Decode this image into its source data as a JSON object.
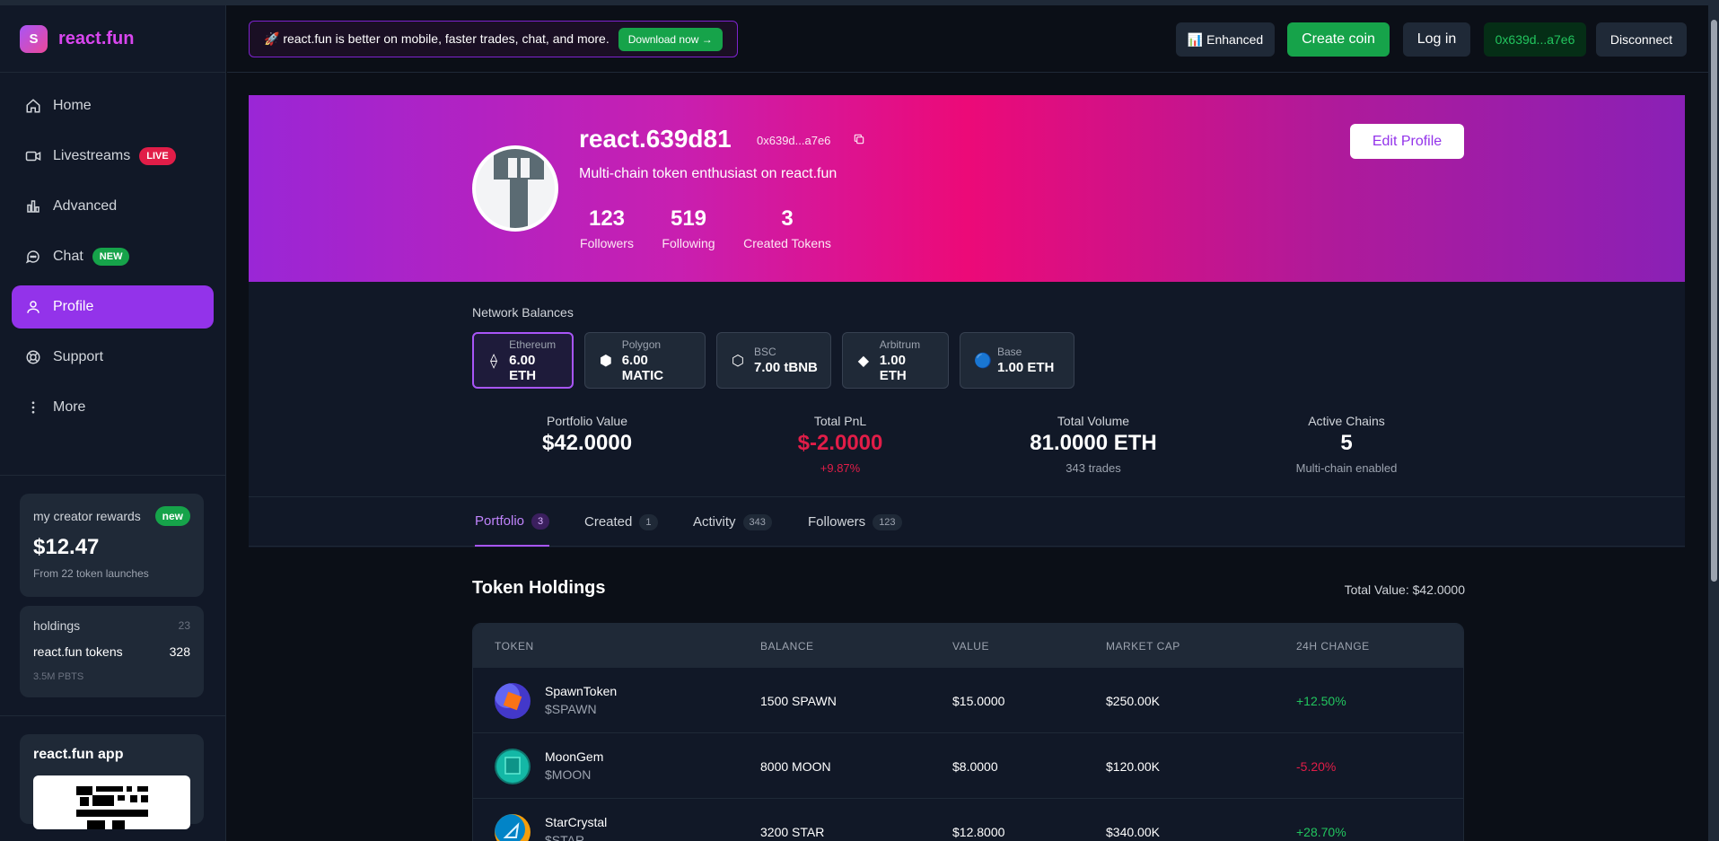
{
  "brand": {
    "logo_letter": "S",
    "name": "react.fun"
  },
  "nav": [
    {
      "label": "Home",
      "icon": "home-icon"
    },
    {
      "label": "Livestreams",
      "icon": "video-icon",
      "badge": "LIVE"
    },
    {
      "label": "Advanced",
      "icon": "bar-chart-icon"
    },
    {
      "label": "Chat",
      "icon": "chat-icon",
      "badge": "NEW"
    },
    {
      "label": "Profile",
      "icon": "user-icon",
      "active": true
    },
    {
      "label": "Support",
      "icon": "lifebuoy-icon"
    },
    {
      "label": "More",
      "icon": "more-vertical-icon"
    }
  ],
  "rewards": {
    "title": "my creator rewards",
    "badge": "new",
    "amount": "$12.47",
    "sub": "From 22 token launches"
  },
  "holdings": {
    "title": "holdings",
    "count": "23",
    "tokens_label": "react.fun tokens",
    "tokens_value": "328",
    "sub": "3.5M PBTS"
  },
  "app_card": {
    "title": "react.fun app"
  },
  "promo": {
    "text": "🚀 react.fun is better on mobile, faster trades, chat, and more.",
    "button": "Download now →"
  },
  "topbar": {
    "enhanced": "📊 Enhanced",
    "create": "Create coin",
    "login": "Log in",
    "wallet": "0x639d...a7e6",
    "disconnect": "Disconnect"
  },
  "profile": {
    "name": "react.639d81",
    "address": "0x639d...a7e6",
    "bio": "Multi-chain token enthusiast on react.fun",
    "edit": "Edit Profile",
    "stats": [
      {
        "num": "123",
        "label": "Followers"
      },
      {
        "num": "519",
        "label": "Following"
      },
      {
        "num": "3",
        "label": "Created Tokens"
      }
    ]
  },
  "networks": {
    "title": "Network Balances",
    "items": [
      {
        "name": "Ethereum",
        "balance": "6.00 ETH",
        "icon": "⟠"
      },
      {
        "name": "Polygon",
        "balance": "6.00 MATIC",
        "icon": "⬢"
      },
      {
        "name": "BSC",
        "balance": "7.00 tBNB",
        "icon": "⬡"
      },
      {
        "name": "Arbitrum",
        "balance": "1.00 ETH",
        "icon": "◆"
      },
      {
        "name": "Base",
        "balance": "1.00 ETH",
        "icon": "🔵"
      }
    ]
  },
  "metrics": [
    {
      "label": "Portfolio Value",
      "value": "$42.0000",
      "sub": ""
    },
    {
      "label": "Total PnL",
      "value": "$-2.0000",
      "sub": "+9.87%"
    },
    {
      "label": "Total Volume",
      "value": "81.0000 ETH",
      "sub": "343 trades"
    },
    {
      "label": "Active Chains",
      "value": "5",
      "sub": "Multi-chain enabled"
    }
  ],
  "tabs": [
    {
      "label": "Portfolio",
      "count": "3"
    },
    {
      "label": "Created",
      "count": "1"
    },
    {
      "label": "Activity",
      "count": "343"
    },
    {
      "label": "Followers",
      "count": "123"
    }
  ],
  "holdings_table": {
    "title": "Token Holdings",
    "total": "Total Value: $42.0000",
    "columns": [
      "TOKEN",
      "BALANCE",
      "VALUE",
      "MARKET CAP",
      "24H CHANGE"
    ],
    "rows": [
      {
        "name": "SpawnToken",
        "symbol": "$SPAWN",
        "balance": "1500 SPAWN",
        "value": "$15.0000",
        "mcap": "$250.00K",
        "change": "+12.50%"
      },
      {
        "name": "MoonGem",
        "symbol": "$MOON",
        "balance": "8000 MOON",
        "value": "$8.0000",
        "mcap": "$120.00K",
        "change": "-5.20%"
      },
      {
        "name": "StarCrystal",
        "symbol": "$STAR",
        "balance": "3200 STAR",
        "value": "$12.8000",
        "mcap": "$340.00K",
        "change": "+28.70%"
      }
    ]
  },
  "colors": {
    "accent": "#9333ea",
    "positive": "#22c55e",
    "negative": "#e11d48",
    "brand_gradient_start": "#a855f7",
    "brand_gradient_end": "#ec4899"
  }
}
